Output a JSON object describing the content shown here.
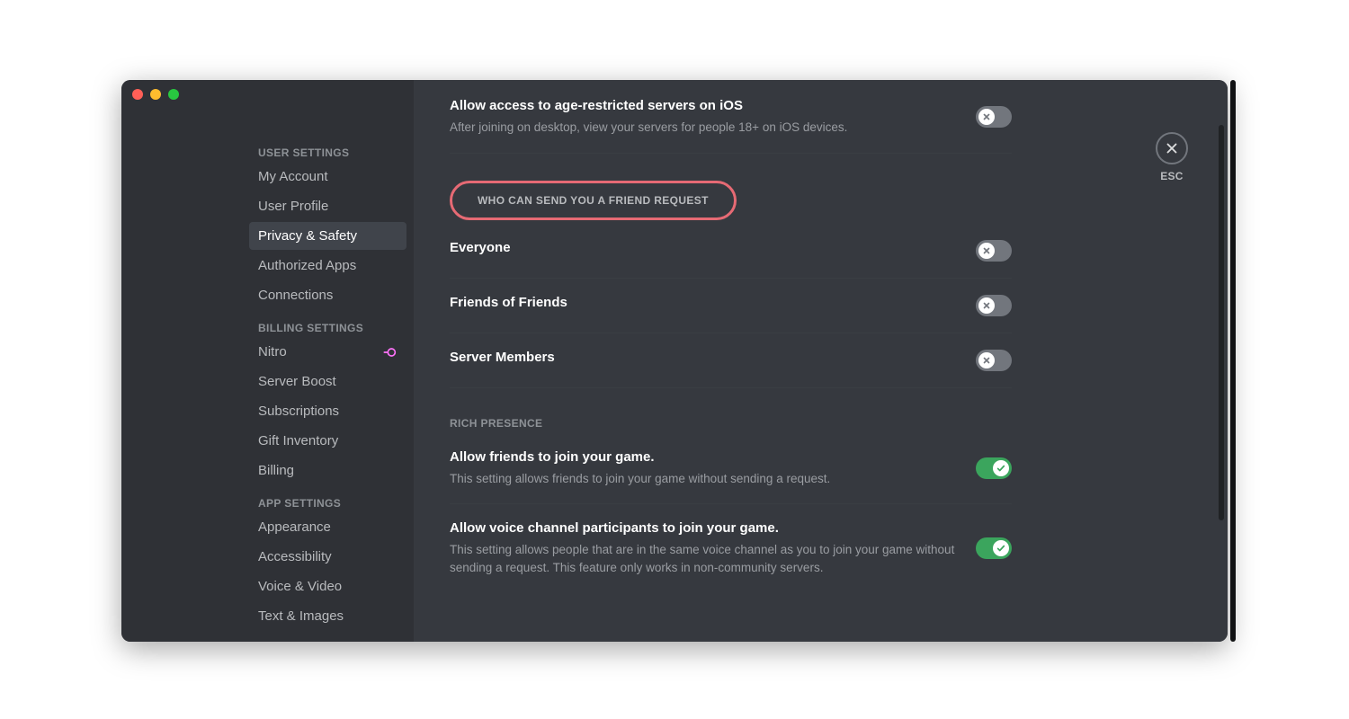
{
  "window": {
    "close_label": "ESC"
  },
  "sidebar": {
    "sections": [
      {
        "header": "USER SETTINGS",
        "items": [
          {
            "label": "My Account",
            "active": false
          },
          {
            "label": "User Profile",
            "active": false
          },
          {
            "label": "Privacy & Safety",
            "active": true
          },
          {
            "label": "Authorized Apps",
            "active": false
          },
          {
            "label": "Connections",
            "active": false
          }
        ]
      },
      {
        "header": "BILLING SETTINGS",
        "items": [
          {
            "label": "Nitro",
            "active": false,
            "badge": "nitro"
          },
          {
            "label": "Server Boost",
            "active": false
          },
          {
            "label": "Subscriptions",
            "active": false
          },
          {
            "label": "Gift Inventory",
            "active": false
          },
          {
            "label": "Billing",
            "active": false
          }
        ]
      },
      {
        "header": "APP SETTINGS",
        "items": [
          {
            "label": "Appearance",
            "active": false
          },
          {
            "label": "Accessibility",
            "active": false
          },
          {
            "label": "Voice & Video",
            "active": false
          },
          {
            "label": "Text & Images",
            "active": false
          }
        ]
      }
    ]
  },
  "content": {
    "age_restricted": {
      "title": "Allow access to age-restricted servers on iOS",
      "desc": "After joining on desktop, view your servers for people 18+ on iOS devices.",
      "on": false
    },
    "friend_request": {
      "header": "WHO CAN SEND YOU A FRIEND REQUEST",
      "options": [
        {
          "label": "Everyone",
          "on": false
        },
        {
          "label": "Friends of Friends",
          "on": false
        },
        {
          "label": "Server Members",
          "on": false
        }
      ]
    },
    "rich_presence": {
      "header": "RICH PRESENCE",
      "settings": [
        {
          "title": "Allow friends to join your game.",
          "desc": "This setting allows friends to join your game without sending a request.",
          "on": true
        },
        {
          "title": "Allow voice channel participants to join your game.",
          "desc": "This setting allows people that are in the same voice channel as you to join your game without sending a request. This feature only works in non-community servers.",
          "on": true
        }
      ]
    }
  }
}
